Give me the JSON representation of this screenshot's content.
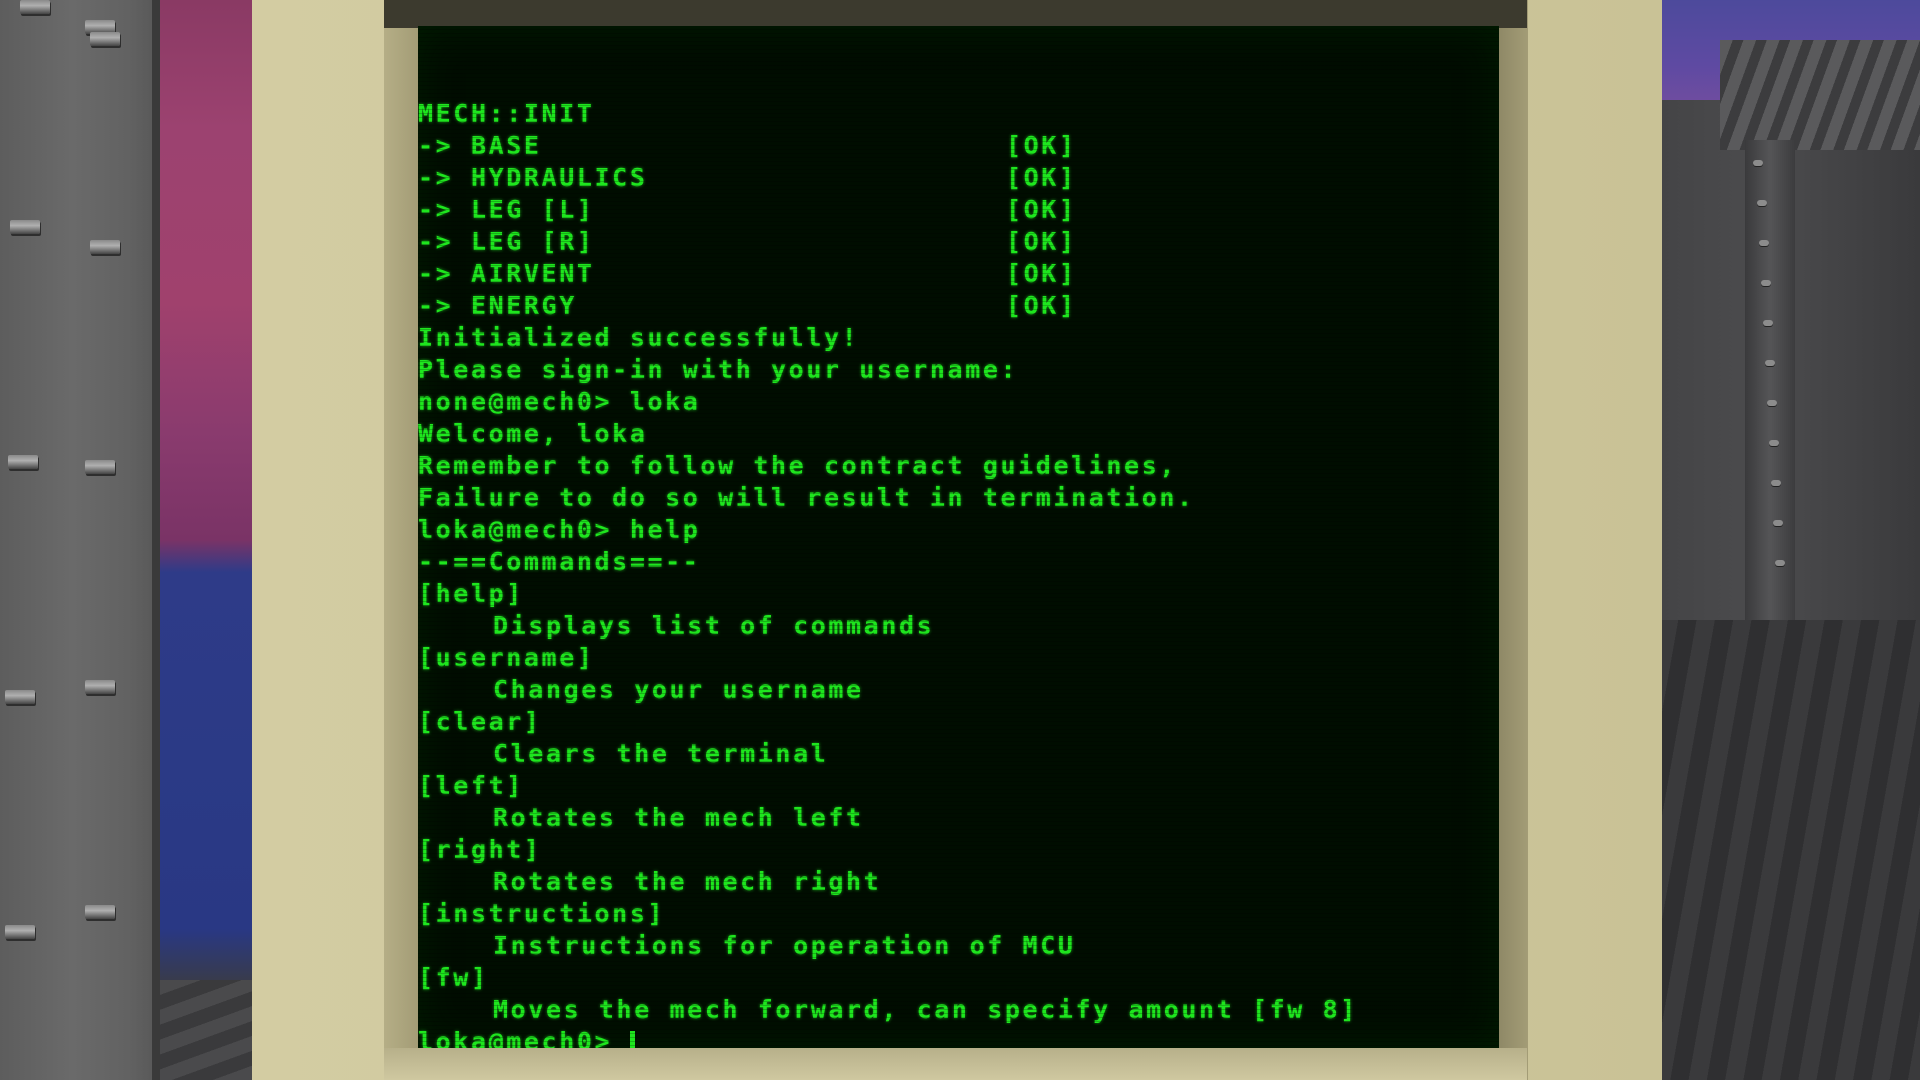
{
  "terminal": {
    "header": "MECH::INIT",
    "boot_checks": [
      {
        "label": "-> BASE",
        "status": "[OK]"
      },
      {
        "label": "-> HYDRAULICS",
        "status": "[OK]"
      },
      {
        "label": "-> LEG [L]",
        "status": "[OK]"
      },
      {
        "label": "-> LEG [R]",
        "status": "[OK]"
      },
      {
        "label": "-> AIRVENT",
        "status": "[OK]"
      },
      {
        "label": "-> ENERGY",
        "status": "[OK]"
      }
    ],
    "messages": [
      "Initialized successfully!",
      "Please sign-in with your username:",
      "none@mech0> loka",
      "Welcome, loka",
      "Remember to follow the contract guidelines,",
      "Failure to do so will result in termination.",
      "loka@mech0> help",
      "--==Commands==--"
    ],
    "commands": [
      {
        "name": "[help]",
        "description": "Displays list of commands"
      },
      {
        "name": "[username]",
        "description": "Changes your username"
      },
      {
        "name": "[clear]",
        "description": "Clears the terminal"
      },
      {
        "name": "[left]",
        "description": "Rotates the mech left"
      },
      {
        "name": "[right]",
        "description": "Rotates the mech right"
      },
      {
        "name": "[instructions]",
        "description": "Instructions for operation of MCU"
      },
      {
        "name": "[fw]",
        "description": "Moves the mech forward, can specify amount [fw 8]"
      }
    ],
    "prompt": "loka@mech0> ",
    "input_value": ""
  },
  "colors": {
    "terminal_text": "#1ee61e",
    "screen_background": "#000d00",
    "monitor_casing": "#d0c99e"
  }
}
